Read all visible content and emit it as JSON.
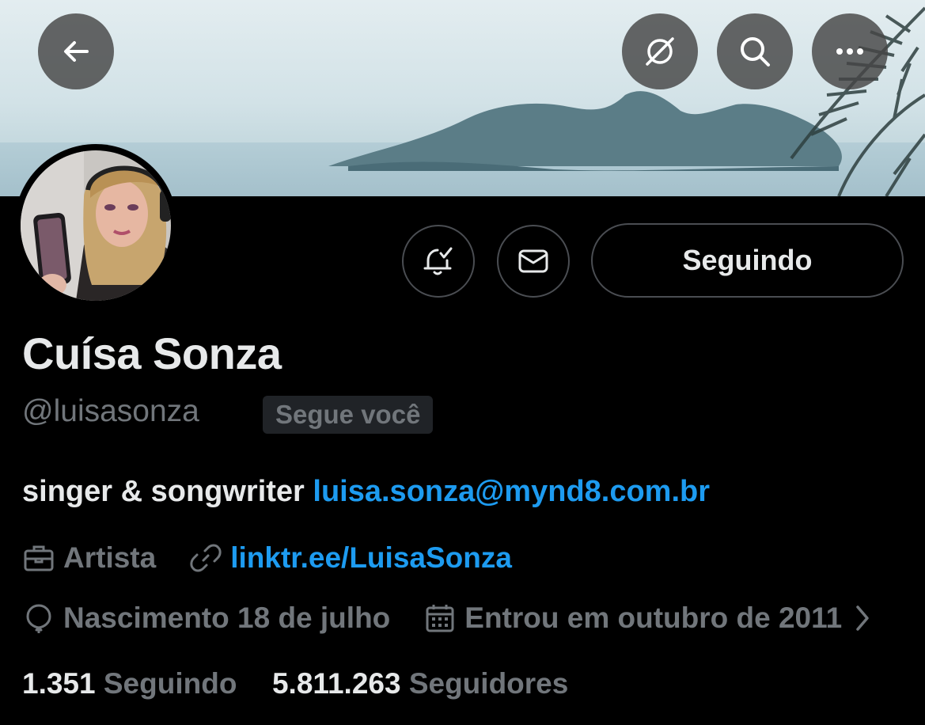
{
  "profile": {
    "display_name": "Cuísa Sonza",
    "handle": "@luisasonza",
    "follows_you_badge": "Segue você",
    "bio_text": "singer & songwriter ",
    "bio_email": "luisa.sonza@mynd8.com.br",
    "category": "Artista",
    "website": "linktr.ee/LuisaSonza",
    "birthday": "Nascimento 18 de julho",
    "joined": "Entrou em outubro de 2011"
  },
  "actions": {
    "following_label": "Seguindo"
  },
  "stats": {
    "following_count": "1.351",
    "following_label": "Seguindo",
    "followers_count": "5.811.263",
    "followers_label": "Seguidores"
  },
  "colors": {
    "background": "#000000",
    "text_primary": "#e7e9ea",
    "text_secondary": "#71767b",
    "link": "#1d9bf0",
    "border": "#4a4d52"
  },
  "icons": {
    "back": "arrow-left-icon",
    "translate": "globe-slash-icon",
    "search": "search-icon",
    "more": "more-horizontal-icon",
    "notifications": "bell-check-icon",
    "message": "envelope-icon",
    "category": "briefcase-icon",
    "website": "link-icon",
    "birthday": "balloon-icon",
    "joined": "calendar-icon"
  }
}
